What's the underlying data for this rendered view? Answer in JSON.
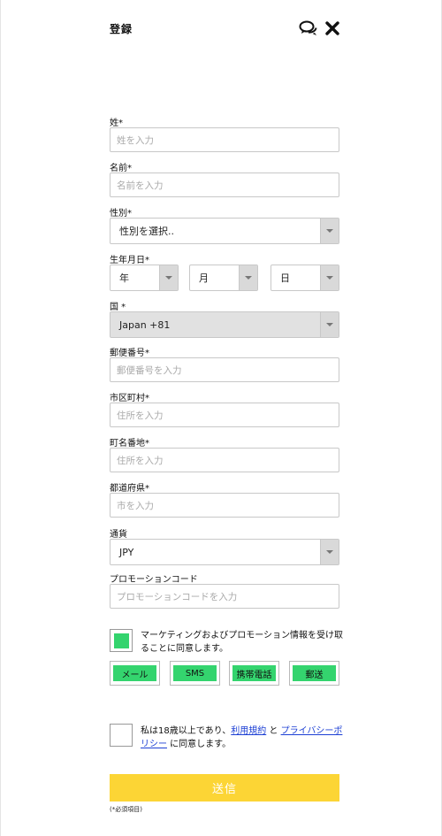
{
  "header": {
    "title": "登録"
  },
  "fields": {
    "last_name": {
      "label": "姓*",
      "placeholder": "姓を入力"
    },
    "first_name": {
      "label": "名前*",
      "placeholder": "名前を入力"
    },
    "gender": {
      "label": "性別*",
      "value": "性別を選択.."
    },
    "birthdate": {
      "label": "生年月日*",
      "year": "年",
      "month": "月",
      "day": "日"
    },
    "country": {
      "label": "国 *",
      "value": "Japan +81"
    },
    "postal_code": {
      "label": "郵便番号*",
      "placeholder": "郵便番号を入力"
    },
    "city": {
      "label": "市区町村*",
      "placeholder": "住所を入力"
    },
    "street": {
      "label": "町名番地*",
      "placeholder": "住所を入力"
    },
    "prefecture": {
      "label": "都道府県*",
      "placeholder": "市を入力"
    },
    "currency": {
      "label": "通貨",
      "value": "JPY"
    },
    "promo_code": {
      "label": "プロモーションコード",
      "placeholder": "プロモーションコードを入力"
    }
  },
  "marketing": {
    "text": "マーケティングおよびプロモーション情報を受け取ることに同意します。",
    "checked": true,
    "channels": [
      "メール",
      "SMS",
      "携帯電話",
      "郵送"
    ],
    "accent_color": "#34d46e"
  },
  "age_agreement": {
    "prefix": "私は18歳以上であり、",
    "terms_link": "利用規約",
    "conjunction": " と ",
    "privacy_link": "プライバシーポリシー",
    "suffix": " に同意します。",
    "checked": false
  },
  "submit": {
    "label": "送信",
    "color": "#fcd535"
  },
  "required_note": "(*必須項目)"
}
